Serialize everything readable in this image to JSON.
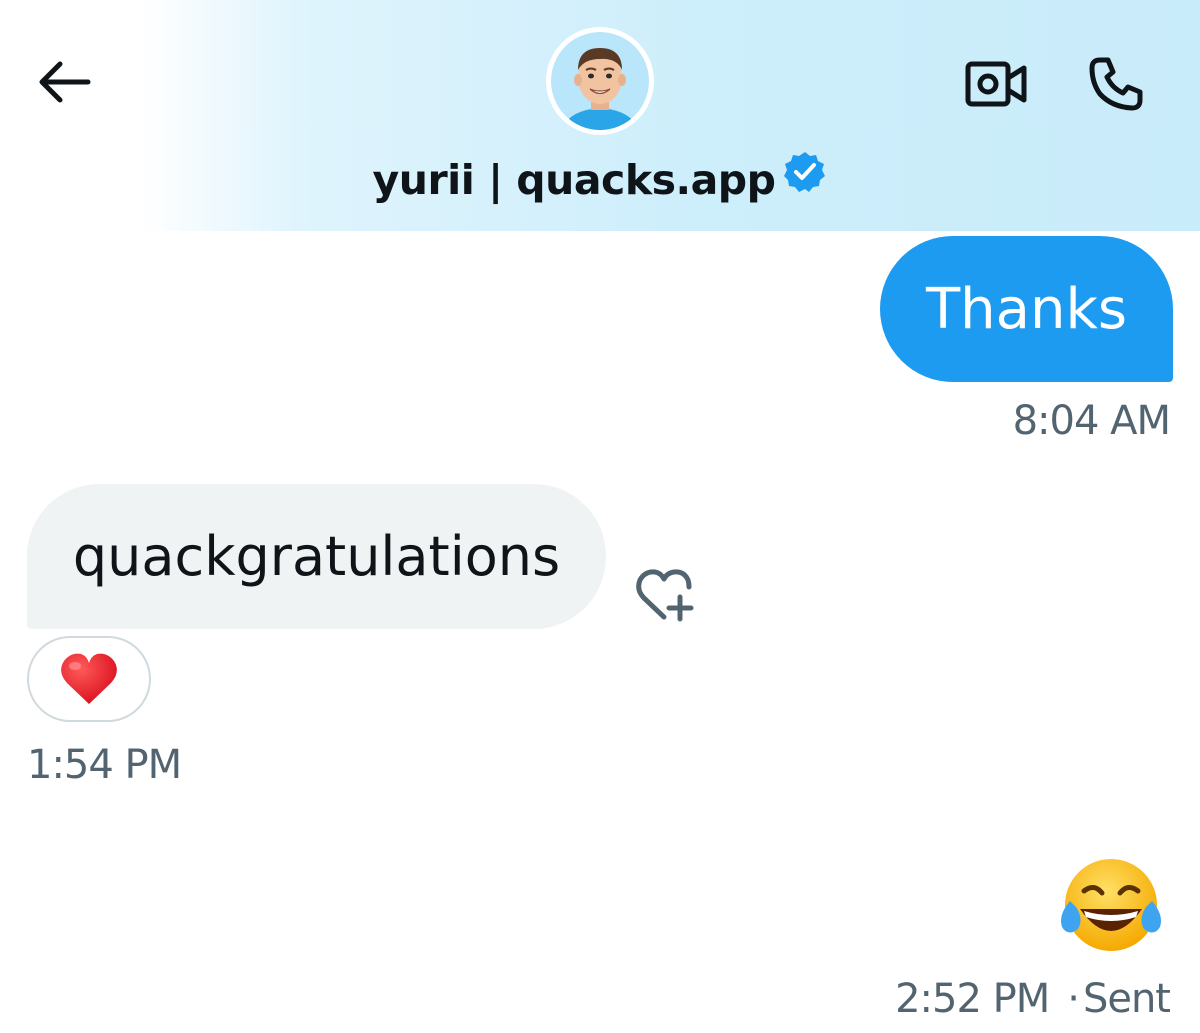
{
  "header": {
    "name": "yurii | quacks.app",
    "verified": true,
    "accent_color": "#1d9bf0"
  },
  "icons": {
    "back": "arrow-left-icon",
    "video": "video-camera-icon",
    "call": "phone-icon",
    "verified": "verified-badge-icon",
    "react": "heart-plus-icon"
  },
  "messages": [
    {
      "direction": "sent",
      "text": "Thanks",
      "time": "8:04 AM"
    },
    {
      "direction": "received",
      "text": "quackgratulations",
      "reaction": "red-heart-emoji",
      "time": "1:54 PM"
    },
    {
      "direction": "sent",
      "emoji": "face-with-tears-of-joy-emoji",
      "time": "2:52 PM",
      "status": "Sent"
    }
  ]
}
